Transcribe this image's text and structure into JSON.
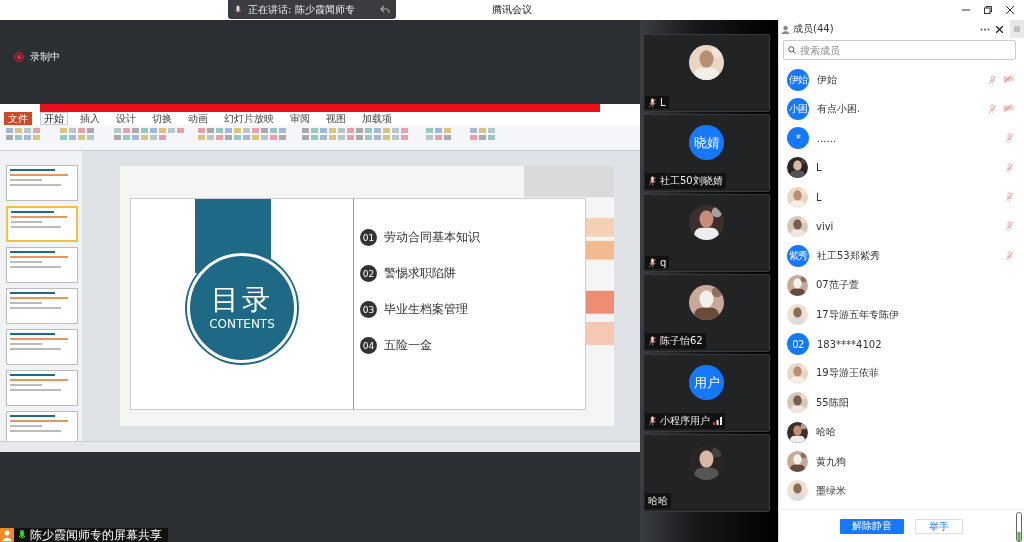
{
  "window": {
    "title": "腾讯会议"
  },
  "speaking": {
    "label": "正在讲话: 陈少霞闻师专"
  },
  "recording": {
    "label": "录制中",
    "on": true
  },
  "share": {
    "ppt_tabs": [
      {
        "label": "文件",
        "selected": false
      },
      {
        "label": "开始",
        "selected": true
      },
      {
        "label": "插入",
        "selected": false
      },
      {
        "label": "设计",
        "selected": false
      },
      {
        "label": "切换",
        "selected": false
      },
      {
        "label": "动画",
        "selected": false
      },
      {
        "label": "幻灯片放映",
        "selected": false
      },
      {
        "label": "审阅",
        "selected": false
      },
      {
        "label": "视图",
        "selected": false
      },
      {
        "label": "加载项",
        "selected": false
      }
    ],
    "thumbnails": [
      {
        "selected": false
      },
      {
        "selected": true
      },
      {
        "selected": false
      },
      {
        "selected": false
      },
      {
        "selected": false
      },
      {
        "selected": false
      },
      {
        "selected": false
      }
    ],
    "slide": {
      "title": "目录",
      "subtitle": "CONTENTS",
      "items": [
        {
          "number": "01",
          "text": "劳动合同基本知识"
        },
        {
          "number": "02",
          "text": "警惕求职陷阱"
        },
        {
          "number": "03",
          "text": "毕业生档案管理"
        },
        {
          "number": "04",
          "text": "五险一金"
        }
      ]
    },
    "caption": "陈少霞闻师专的屏幕共享"
  },
  "videos": [
    {
      "name": "L",
      "mic": true,
      "signal": false
    },
    {
      "name": "社工50刘晓婧",
      "avatar": {
        "kind": "text",
        "text": "晓婧"
      },
      "mic": true,
      "signal": false
    },
    {
      "name": "q",
      "mic": true,
      "signal": false
    },
    {
      "name": "陈子怡62",
      "mic": true,
      "signal": false
    },
    {
      "name": "小程序用户",
      "avatar": {
        "kind": "text",
        "text": "用户"
      },
      "mic": true,
      "signal": true
    },
    {
      "name": "哈哈",
      "mic": false,
      "signal": false
    }
  ],
  "members": {
    "title": "成员(44)",
    "search": {
      "placeholder": "搜索成员"
    },
    "items": [
      {
        "name": "伊始",
        "avatar": {
          "kind": "text",
          "text": "伊始"
        },
        "mic_muted": true,
        "camera_off": true
      },
      {
        "name": "有点小困.",
        "avatar": {
          "kind": "text",
          "text": "小困"
        },
        "mic_muted": true,
        "camera_off": true
      },
      {
        "name": "......",
        "avatar": {
          "kind": "text",
          "text": "*"
        },
        "mic_muted": true,
        "camera_off": false
      },
      {
        "name": "L",
        "mic_muted": true,
        "camera_off": false
      },
      {
        "name": "L",
        "mic_muted": true,
        "camera_off": false
      },
      {
        "name": "vivi",
        "mic_muted": true,
        "camera_off": false
      },
      {
        "name": "社工53郑紫秀",
        "avatar": {
          "kind": "text",
          "text": "紫秀"
        },
        "mic_muted": true,
        "camera_off": false
      },
      {
        "name": "07范子萱",
        "mic_muted": false,
        "camera_off": false
      },
      {
        "name": "17导游五年专陈伊",
        "mic_muted": false,
        "camera_off": false
      },
      {
        "name": "183****4102",
        "avatar": {
          "kind": "text",
          "text": "02"
        },
        "mic_muted": false,
        "camera_off": false
      },
      {
        "name": "19导游王依菲",
        "mic_muted": false,
        "camera_off": false
      },
      {
        "name": "55陈阳",
        "mic_muted": false,
        "camera_off": false
      },
      {
        "name": "哈哈",
        "mic_muted": false,
        "camera_off": false
      },
      {
        "name": "黄九狗",
        "mic_muted": false,
        "camera_off": false
      },
      {
        "name": "墨绿米",
        "mic_muted": false,
        "camera_off": false
      }
    ],
    "buttons": [
      {
        "label": "解除静音",
        "primary": true
      },
      {
        "label": "举手",
        "primary": false
      }
    ]
  }
}
